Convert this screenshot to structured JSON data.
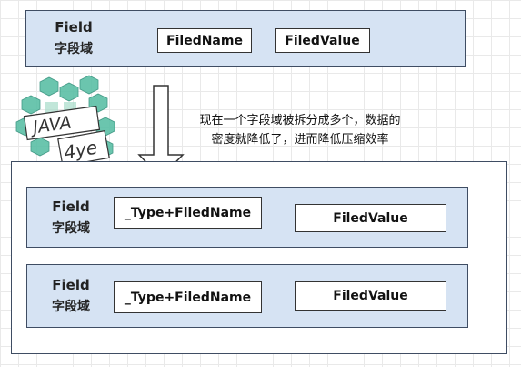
{
  "top_group": {
    "label_en": "Field",
    "label_zh": "字段域",
    "boxes": [
      "FiledName",
      "FiledValue"
    ]
  },
  "note": {
    "line1": "现在一个字段域被拆分成多个，数据的",
    "line2": "密度就降低了，进而降低压缩效率"
  },
  "bottom_groups": [
    {
      "label_en": "Field",
      "label_zh": "字段域",
      "boxes": [
        "_Type+FiledName",
        "FiledValue"
      ]
    },
    {
      "label_en": "Field",
      "label_zh": "字段域",
      "boxes": [
        "_Type+FiledName",
        "FiledValue"
      ]
    }
  ],
  "logo": {
    "text1": "JAVA",
    "text2": "4ye"
  },
  "colors": {
    "panel": "#d6e3f3",
    "border": "#3f4d63",
    "logo_green": "#4db8a0"
  }
}
